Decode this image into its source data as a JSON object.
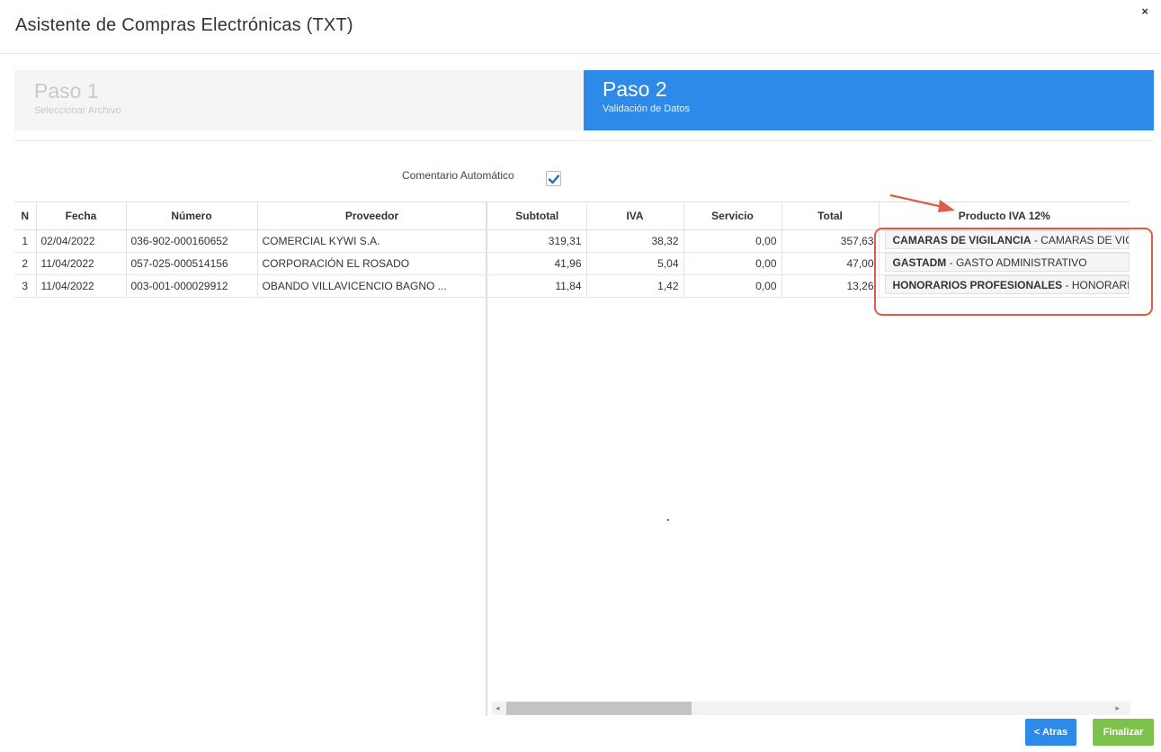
{
  "dialog": {
    "title": "Asistente de Compras Electrónicas (TXT)",
    "close_label": "×"
  },
  "steps": [
    {
      "title": "Paso 1",
      "subtitle": "Seleccionar Archivo",
      "active": false
    },
    {
      "title": "Paso 2",
      "subtitle": "Validación de Datos",
      "active": true
    }
  ],
  "auto_comment": {
    "label": "Comentario Automático",
    "checked": true
  },
  "table": {
    "left_headers": [
      "N",
      "Fecha",
      "Número",
      "Proveedor"
    ],
    "right_headers": [
      "Subtotal",
      "IVA",
      "Servicio",
      "Total",
      "Producto IVA 12%"
    ],
    "rows": [
      {
        "n": "1",
        "fecha": "02/04/2022",
        "numero": "036-902-000160652",
        "proveedor": "COMERCIAL KYWI S.A.",
        "subtotal": "319,31",
        "iva": "38,32",
        "servicio": "0,00",
        "total": "357,63",
        "producto_code": "CAMARAS DE VIGILANCIA",
        "producto_desc": " - CAMARAS DE VIG"
      },
      {
        "n": "2",
        "fecha": "11/04/2022",
        "numero": "057-025-000514156",
        "proveedor": "CORPORACIÓN EL ROSADO",
        "subtotal": "41,96",
        "iva": "5,04",
        "servicio": "0,00",
        "total": "47,00",
        "producto_code": "GASTADM",
        "producto_desc": " - GASTO ADMINISTRATIVO"
      },
      {
        "n": "3",
        "fecha": "11/04/2022",
        "numero": "003-001-000029912",
        "proveedor": "OBANDO VILLAVICENCIO BAGNO ...",
        "subtotal": "11,84",
        "iva": "1,42",
        "servicio": "0,00",
        "total": "13,26",
        "producto_code": "HONORARIOS PROFESIONALES",
        "producto_desc": " - HONORARIO"
      }
    ]
  },
  "scrollbar": {
    "left_arrow": "◂",
    "right_arrow": "▸"
  },
  "buttons": {
    "back": "< Atras",
    "finish": "Finalizar"
  },
  "colors": {
    "active_step": "#2d8ae8",
    "finish_button": "#7ec24d",
    "annotation": "#de5a49"
  }
}
